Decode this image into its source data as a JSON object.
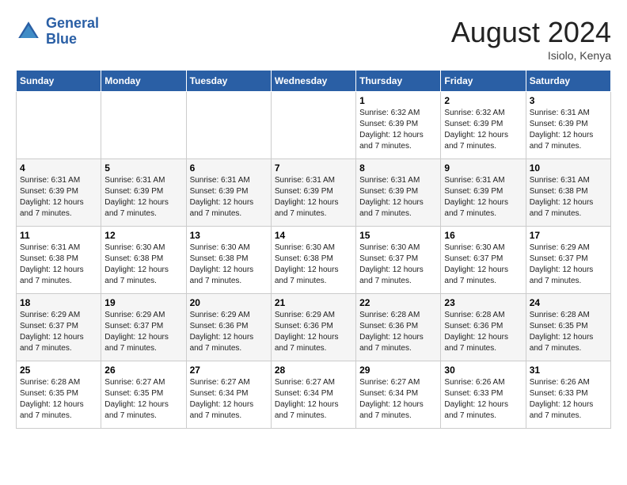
{
  "header": {
    "logo_line1": "General",
    "logo_line2": "Blue",
    "month_year": "August 2024",
    "location": "Isiolo, Kenya"
  },
  "weekdays": [
    "Sunday",
    "Monday",
    "Tuesday",
    "Wednesday",
    "Thursday",
    "Friday",
    "Saturday"
  ],
  "weeks": [
    [
      {
        "day": "",
        "info": ""
      },
      {
        "day": "",
        "info": ""
      },
      {
        "day": "",
        "info": ""
      },
      {
        "day": "",
        "info": ""
      },
      {
        "day": "1",
        "info": "Sunrise: 6:32 AM\nSunset: 6:39 PM\nDaylight: 12 hours\nand 7 minutes."
      },
      {
        "day": "2",
        "info": "Sunrise: 6:32 AM\nSunset: 6:39 PM\nDaylight: 12 hours\nand 7 minutes."
      },
      {
        "day": "3",
        "info": "Sunrise: 6:31 AM\nSunset: 6:39 PM\nDaylight: 12 hours\nand 7 minutes."
      }
    ],
    [
      {
        "day": "4",
        "info": "Sunrise: 6:31 AM\nSunset: 6:39 PM\nDaylight: 12 hours\nand 7 minutes."
      },
      {
        "day": "5",
        "info": "Sunrise: 6:31 AM\nSunset: 6:39 PM\nDaylight: 12 hours\nand 7 minutes."
      },
      {
        "day": "6",
        "info": "Sunrise: 6:31 AM\nSunset: 6:39 PM\nDaylight: 12 hours\nand 7 minutes."
      },
      {
        "day": "7",
        "info": "Sunrise: 6:31 AM\nSunset: 6:39 PM\nDaylight: 12 hours\nand 7 minutes."
      },
      {
        "day": "8",
        "info": "Sunrise: 6:31 AM\nSunset: 6:39 PM\nDaylight: 12 hours\nand 7 minutes."
      },
      {
        "day": "9",
        "info": "Sunrise: 6:31 AM\nSunset: 6:39 PM\nDaylight: 12 hours\nand 7 minutes."
      },
      {
        "day": "10",
        "info": "Sunrise: 6:31 AM\nSunset: 6:38 PM\nDaylight: 12 hours\nand 7 minutes."
      }
    ],
    [
      {
        "day": "11",
        "info": "Sunrise: 6:31 AM\nSunset: 6:38 PM\nDaylight: 12 hours\nand 7 minutes."
      },
      {
        "day": "12",
        "info": "Sunrise: 6:30 AM\nSunset: 6:38 PM\nDaylight: 12 hours\nand 7 minutes."
      },
      {
        "day": "13",
        "info": "Sunrise: 6:30 AM\nSunset: 6:38 PM\nDaylight: 12 hours\nand 7 minutes."
      },
      {
        "day": "14",
        "info": "Sunrise: 6:30 AM\nSunset: 6:38 PM\nDaylight: 12 hours\nand 7 minutes."
      },
      {
        "day": "15",
        "info": "Sunrise: 6:30 AM\nSunset: 6:37 PM\nDaylight: 12 hours\nand 7 minutes."
      },
      {
        "day": "16",
        "info": "Sunrise: 6:30 AM\nSunset: 6:37 PM\nDaylight: 12 hours\nand 7 minutes."
      },
      {
        "day": "17",
        "info": "Sunrise: 6:29 AM\nSunset: 6:37 PM\nDaylight: 12 hours\nand 7 minutes."
      }
    ],
    [
      {
        "day": "18",
        "info": "Sunrise: 6:29 AM\nSunset: 6:37 PM\nDaylight: 12 hours\nand 7 minutes."
      },
      {
        "day": "19",
        "info": "Sunrise: 6:29 AM\nSunset: 6:37 PM\nDaylight: 12 hours\nand 7 minutes."
      },
      {
        "day": "20",
        "info": "Sunrise: 6:29 AM\nSunset: 6:36 PM\nDaylight: 12 hours\nand 7 minutes."
      },
      {
        "day": "21",
        "info": "Sunrise: 6:29 AM\nSunset: 6:36 PM\nDaylight: 12 hours\nand 7 minutes."
      },
      {
        "day": "22",
        "info": "Sunrise: 6:28 AM\nSunset: 6:36 PM\nDaylight: 12 hours\nand 7 minutes."
      },
      {
        "day": "23",
        "info": "Sunrise: 6:28 AM\nSunset: 6:36 PM\nDaylight: 12 hours\nand 7 minutes."
      },
      {
        "day": "24",
        "info": "Sunrise: 6:28 AM\nSunset: 6:35 PM\nDaylight: 12 hours\nand 7 minutes."
      }
    ],
    [
      {
        "day": "25",
        "info": "Sunrise: 6:28 AM\nSunset: 6:35 PM\nDaylight: 12 hours\nand 7 minutes."
      },
      {
        "day": "26",
        "info": "Sunrise: 6:27 AM\nSunset: 6:35 PM\nDaylight: 12 hours\nand 7 minutes."
      },
      {
        "day": "27",
        "info": "Sunrise: 6:27 AM\nSunset: 6:34 PM\nDaylight: 12 hours\nand 7 minutes."
      },
      {
        "day": "28",
        "info": "Sunrise: 6:27 AM\nSunset: 6:34 PM\nDaylight: 12 hours\nand 7 minutes."
      },
      {
        "day": "29",
        "info": "Sunrise: 6:27 AM\nSunset: 6:34 PM\nDaylight: 12 hours\nand 7 minutes."
      },
      {
        "day": "30",
        "info": "Sunrise: 6:26 AM\nSunset: 6:33 PM\nDaylight: 12 hours\nand 7 minutes."
      },
      {
        "day": "31",
        "info": "Sunrise: 6:26 AM\nSunset: 6:33 PM\nDaylight: 12 hours\nand 7 minutes."
      }
    ]
  ]
}
